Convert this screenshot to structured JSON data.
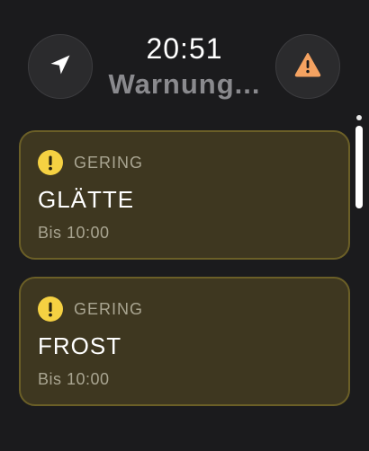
{
  "header": {
    "time": "20:51",
    "subtitle": "Warnung..."
  },
  "buttons": {
    "location_icon": "location-arrow-icon",
    "warning_icon": "warning-triangle-icon",
    "warning_color": "#f4a261"
  },
  "warnings": [
    {
      "level": "GERING",
      "title": "GLÄTTE",
      "until": "Bis 10:00",
      "level_icon": "exclamation-circle-icon",
      "level_color": "#f5d142"
    },
    {
      "level": "GERING",
      "title": "FROST",
      "until": "Bis 10:00",
      "level_icon": "exclamation-circle-icon",
      "level_color": "#f5d142"
    }
  ]
}
